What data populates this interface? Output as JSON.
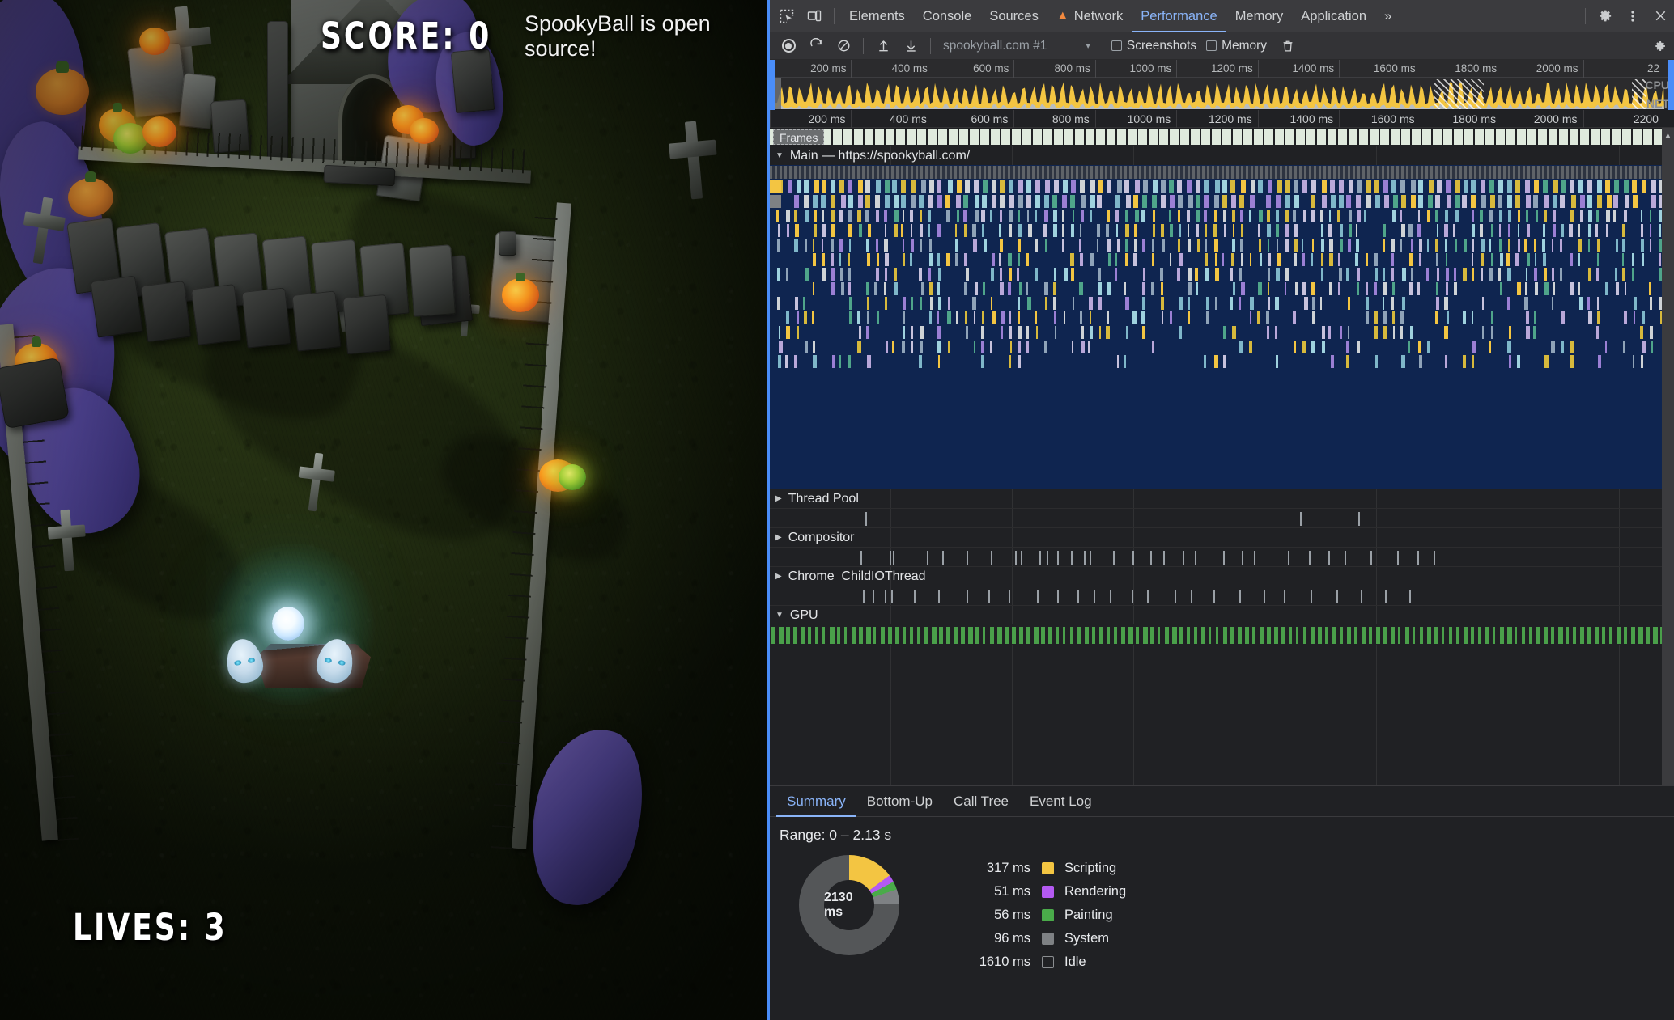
{
  "game": {
    "title": "SpookyBall",
    "score_label": "SCORE: 0",
    "lives_label": "LIVES: 3",
    "open_source_note": "SpookyBall is open source!"
  },
  "devtools": {
    "tabs": [
      {
        "label": "Elements",
        "active": false,
        "warn": false
      },
      {
        "label": "Console",
        "active": false,
        "warn": false
      },
      {
        "label": "Sources",
        "active": false,
        "warn": false
      },
      {
        "label": "Network",
        "active": false,
        "warn": true
      },
      {
        "label": "Performance",
        "active": true,
        "warn": false
      },
      {
        "label": "Memory",
        "active": false,
        "warn": false
      },
      {
        "label": "Application",
        "active": false,
        "warn": false
      }
    ],
    "more_tabs_label": "»",
    "icons": {
      "inspect": "inspect-element-icon",
      "device": "device-toolbar-icon",
      "settings": "gear-icon",
      "kebab": "more-options-icon",
      "close": "close-icon"
    },
    "toolbar": {
      "record_title": "Record",
      "reload_title": "Start profiling and reload page",
      "clear_title": "Clear",
      "upload_title": "Load profile",
      "download_title": "Save profile",
      "profile_name": "spookyball.com #1",
      "caret": "▾",
      "screenshots_label": "Screenshots",
      "screenshots_checked": false,
      "memory_label": "Memory",
      "memory_checked": false,
      "trash_title": "Collect garbage",
      "capture_settings_title": "Capture settings"
    },
    "overview": {
      "ticks": [
        "200 ms",
        "400 ms",
        "600 ms",
        "800 ms",
        "1000 ms",
        "1200 ms",
        "1400 ms",
        "1600 ms",
        "1800 ms",
        "2000 ms",
        "22"
      ],
      "cpu_label": "CPU",
      "net_label": "NET"
    },
    "ruler": {
      "ticks": [
        "200 ms",
        "400 ms",
        "600 ms",
        "800 ms",
        "1000 ms",
        "1200 ms",
        "1400 ms",
        "1600 ms",
        "1800 ms",
        "2000 ms",
        "2200"
      ]
    },
    "tracks": {
      "frames_label": "Frames",
      "main_label": "Main — https://spookyball.com/",
      "thread_pool_label": "Thread Pool",
      "compositor_label": "Compositor",
      "child_io_label": "Chrome_ChildIOThread",
      "gpu_label": "GPU"
    },
    "bottom": {
      "tabs": [
        {
          "label": "Summary",
          "active": true
        },
        {
          "label": "Bottom-Up",
          "active": false
        },
        {
          "label": "Call Tree",
          "active": false
        },
        {
          "label": "Event Log",
          "active": false
        }
      ],
      "range_label": "Range: 0 – 2.13 s",
      "donut_center": "2130 ms"
    }
  },
  "chart_data": {
    "type": "pie",
    "title": "Range: 0 – 2.13 s",
    "total_label": "2130 ms",
    "total": 2130,
    "unit": "ms",
    "legend_position": "right",
    "categories": [
      "Scripting",
      "Rendering",
      "Painting",
      "System",
      "Idle"
    ],
    "values": [
      317,
      51,
      56,
      96,
      1610
    ],
    "labels": [
      "317 ms",
      "51 ms",
      "56 ms",
      "96 ms",
      "1610 ms"
    ],
    "colors": [
      "#f3c542",
      "#b45af2",
      "#4aab4a",
      "#7e8184",
      "#545658"
    ]
  }
}
